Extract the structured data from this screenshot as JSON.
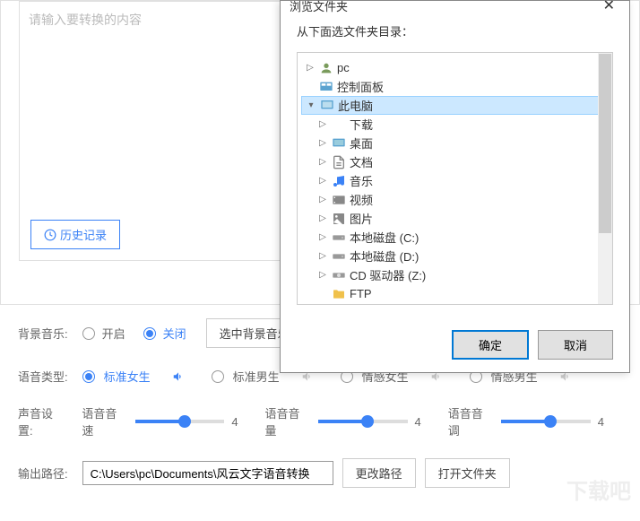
{
  "main": {
    "placeholder": "请输入要转换的内容",
    "history_btn": "历史记录"
  },
  "bg_music": {
    "label": "背景音乐:",
    "on": "开启",
    "off": "关闭",
    "select_btn": "选中背景音乐"
  },
  "voice_type": {
    "label": "语音类型:",
    "options": [
      "标准女生",
      "标准男生",
      "情感女生",
      "情感男生"
    ]
  },
  "sound": {
    "label": "声音设置:",
    "speed": {
      "label": "语音音速",
      "value": "4"
    },
    "volume": {
      "label": "语音音量",
      "value": "4"
    },
    "pitch": {
      "label": "语音音调",
      "value": "4"
    }
  },
  "output": {
    "label": "输出路径:",
    "path": "C:\\Users\\pc\\Documents\\风云文字语音转换",
    "change_btn": "更改路径",
    "open_btn": "打开文件夹"
  },
  "dialog": {
    "title": "浏览文件夹",
    "subtitle": "从下面选文件夹目录：",
    "ok": "确定",
    "cancel": "取消",
    "tree": [
      {
        "label": "pc",
        "icon": "user",
        "indent": 0,
        "expand": "▷"
      },
      {
        "label": "控制面板",
        "icon": "panel",
        "indent": 0,
        "expand": ""
      },
      {
        "label": "此电脑",
        "icon": "monitor",
        "indent": 0,
        "expand": "▾",
        "selected": true
      },
      {
        "label": "下载",
        "icon": "download",
        "indent": 1,
        "expand": "▷"
      },
      {
        "label": "桌面",
        "icon": "desktop",
        "indent": 1,
        "expand": "▷"
      },
      {
        "label": "文档",
        "icon": "doc",
        "indent": 1,
        "expand": "▷"
      },
      {
        "label": "音乐",
        "icon": "music",
        "indent": 1,
        "expand": "▷"
      },
      {
        "label": "视频",
        "icon": "video",
        "indent": 1,
        "expand": "▷"
      },
      {
        "label": "图片",
        "icon": "image",
        "indent": 1,
        "expand": "▷"
      },
      {
        "label": "本地磁盘 (C:)",
        "icon": "drive",
        "indent": 1,
        "expand": "▷"
      },
      {
        "label": "本地磁盘 (D:)",
        "icon": "drive",
        "indent": 1,
        "expand": "▷"
      },
      {
        "label": "CD 驱动器 (Z:)",
        "icon": "cd",
        "indent": 1,
        "expand": "▷"
      },
      {
        "label": "FTP",
        "icon": "folder",
        "indent": 1,
        "expand": ""
      }
    ]
  },
  "watermark": "下载吧"
}
